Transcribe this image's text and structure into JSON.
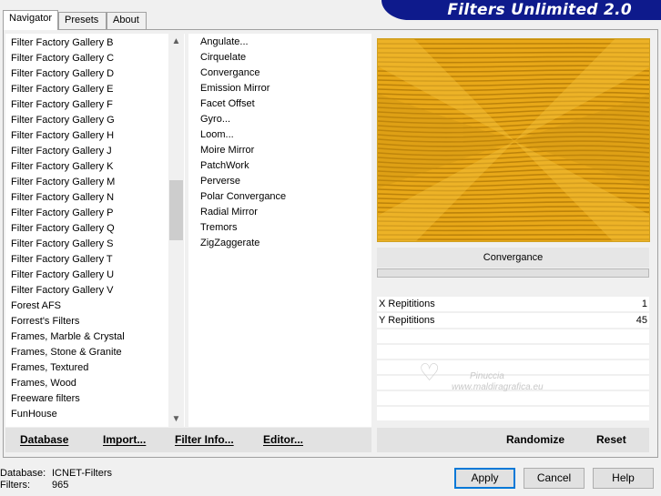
{
  "tabs": [
    {
      "label": "Navigator",
      "active": true
    },
    {
      "label": "Presets",
      "active": false
    },
    {
      "label": "About",
      "active": false
    }
  ],
  "app_title": "Filters Unlimited 2.0",
  "colors": {
    "banner": "#0e1a8c",
    "preview_gold": "#e8a818",
    "preview_dark": "#b07808",
    "default_button_border": "#0078d7"
  },
  "categories": [
    "Filter Factory Gallery B",
    "Filter Factory Gallery C",
    "Filter Factory Gallery D",
    "Filter Factory Gallery E",
    "Filter Factory Gallery F",
    "Filter Factory Gallery G",
    "Filter Factory Gallery H",
    "Filter Factory Gallery J",
    "Filter Factory Gallery K",
    "Filter Factory Gallery M",
    "Filter Factory Gallery N",
    "Filter Factory Gallery P",
    "Filter Factory Gallery Q",
    "Filter Factory Gallery S",
    "Filter Factory Gallery T",
    "Filter Factory Gallery U",
    "Filter Factory Gallery V",
    "Forest AFS",
    "Forrest's Filters",
    "Frames, Marble & Crystal",
    "Frames, Stone & Granite",
    "Frames, Textured",
    "Frames, Wood",
    "Freeware filters",
    "FunHouse"
  ],
  "scrollbar": {
    "up_icon": "chevron-up-icon",
    "down_icon": "chevron-down-icon"
  },
  "filters": [
    "Angulate...",
    "Cirquelate",
    "Convergance",
    "Emission Mirror",
    "Facet Offset",
    "Gyro...",
    "Loom...",
    "Moire Mirror",
    "PatchWork",
    "Perverse",
    "Polar Convergance",
    "Radial Mirror",
    "Tremors",
    "ZigZaggerate"
  ],
  "selected_filter": "Convergance",
  "preview_label": "Convergance",
  "parameters": [
    {
      "label": "X Repititions",
      "value": "1"
    },
    {
      "label": "Y Repititions",
      "value": "45"
    }
  ],
  "watermark": {
    "line1": "Pinuccia",
    "line2": "www.maldiragrafica.eu"
  },
  "toolbar": {
    "database": "Database",
    "import": "Import...",
    "filter_info": "Filter Info...",
    "editor": "Editor...",
    "randomize": "Randomize",
    "reset": "Reset"
  },
  "status": {
    "database_key": "Database:",
    "database_value": "ICNET-Filters",
    "filters_key": "Filters:",
    "filters_value": "965"
  },
  "buttons": {
    "apply": "Apply",
    "cancel": "Cancel",
    "help": "Help"
  }
}
